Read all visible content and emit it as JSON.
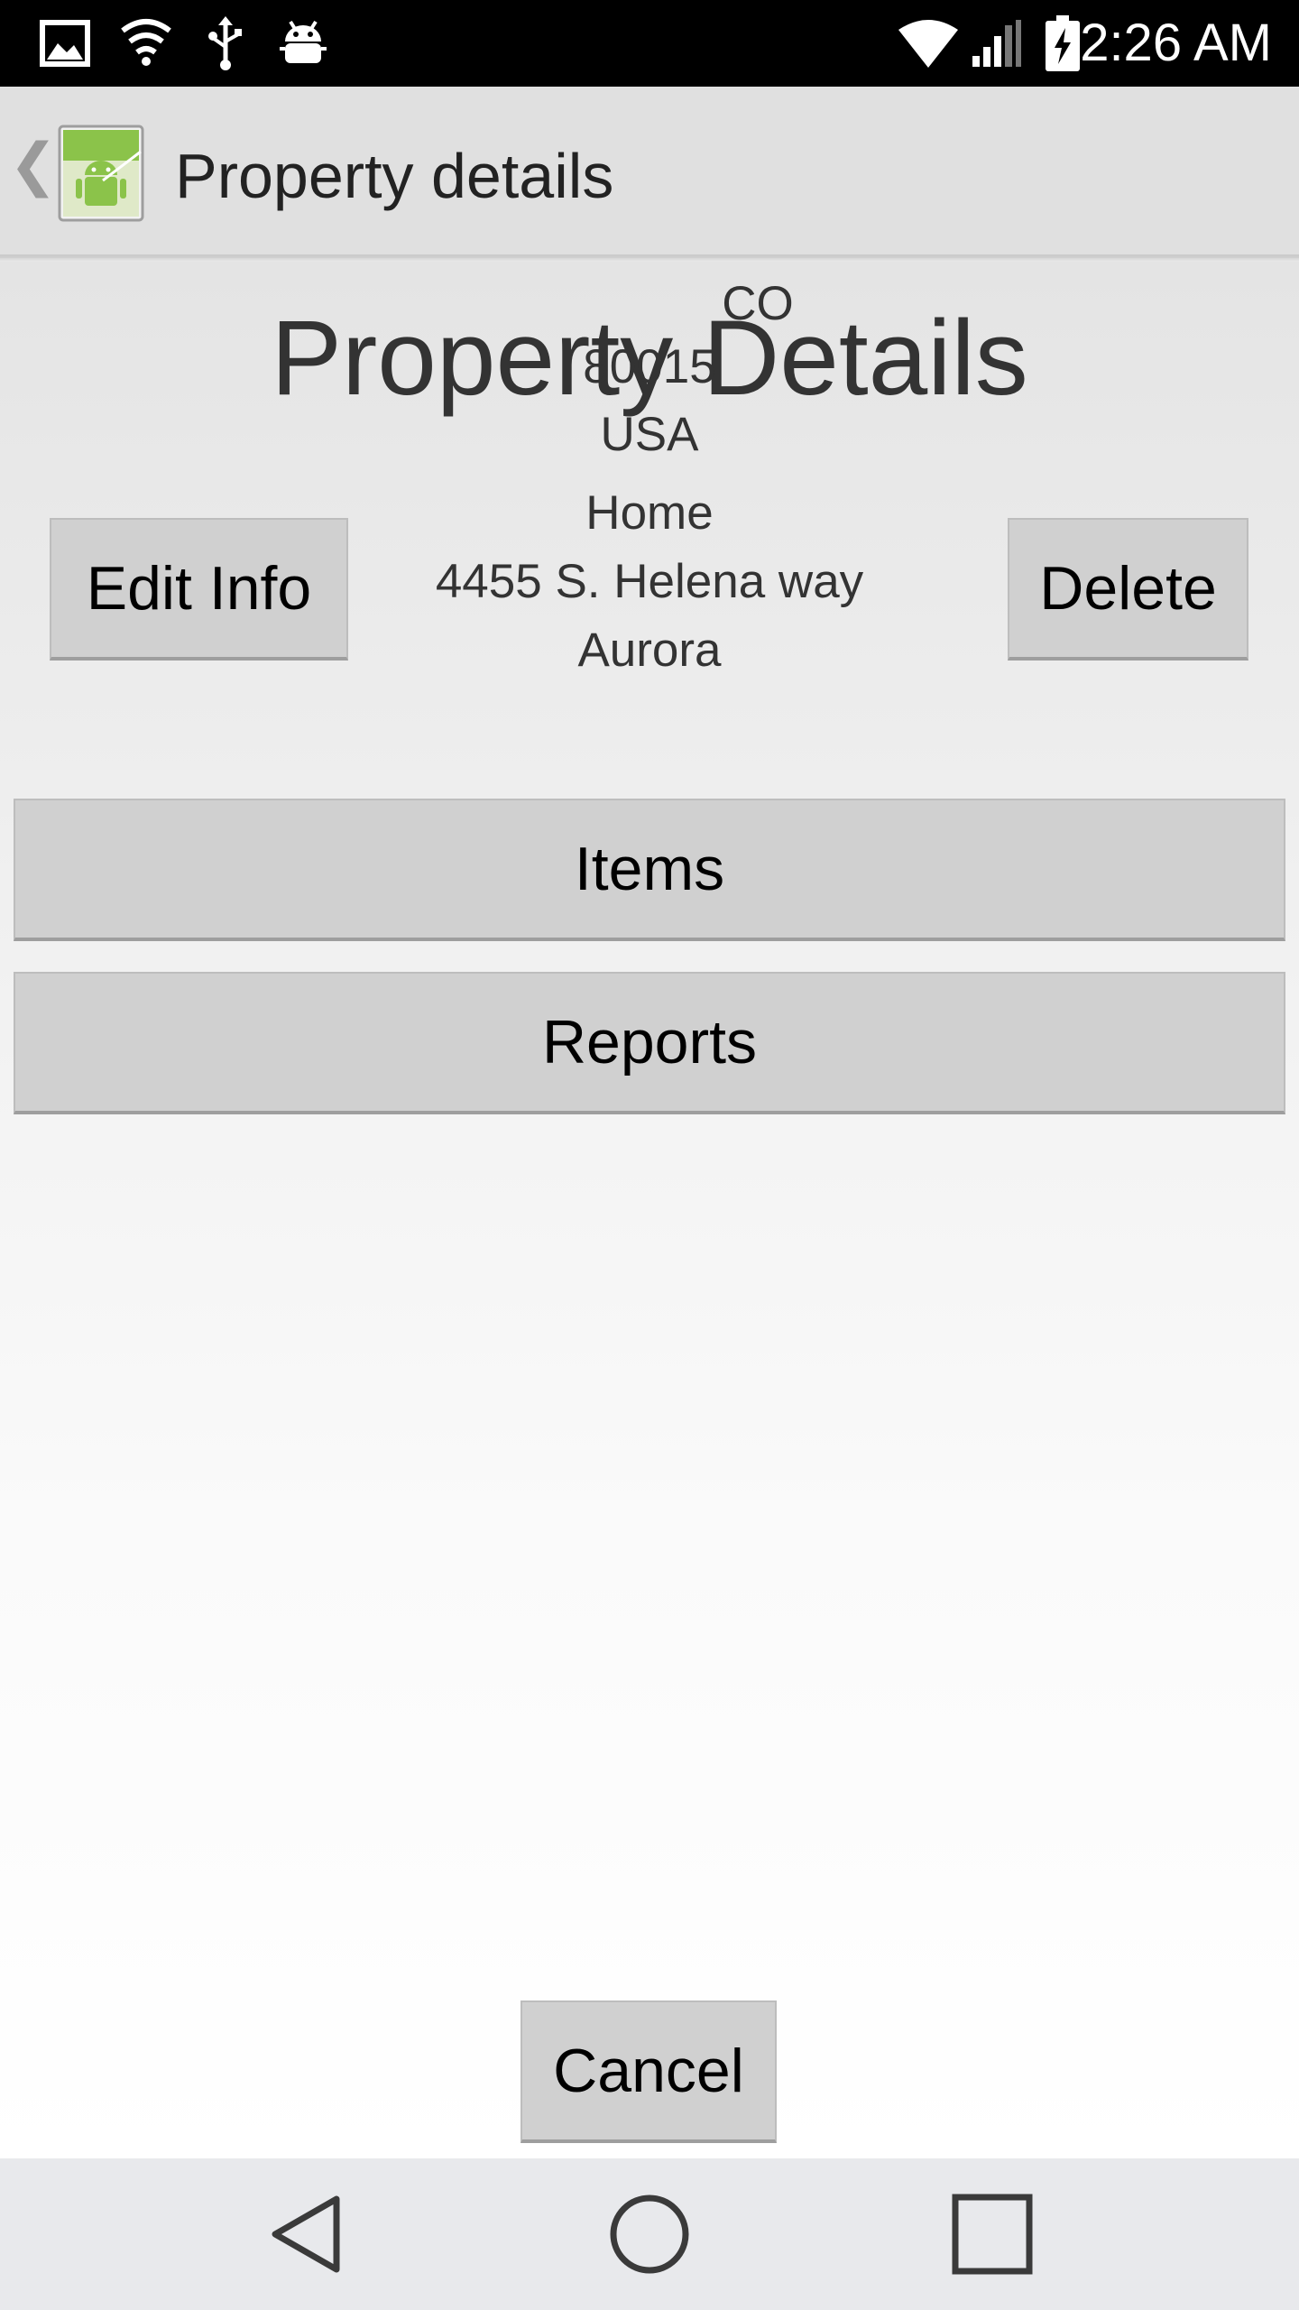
{
  "status_bar": {
    "time": "2:26 AM",
    "left_icons": [
      "image-icon",
      "shield-wifi-icon",
      "usb-icon",
      "android-debug-icon"
    ],
    "right_icons": [
      "wifi-icon",
      "signal-icon",
      "battery-charging-icon"
    ]
  },
  "action_bar": {
    "title": "Property details"
  },
  "main": {
    "page_title": "Property Details",
    "address": {
      "state": "CO",
      "zip": "80015",
      "country": "USA",
      "name": "Home",
      "street": "4455 S. Helena way",
      "city": "Aurora"
    },
    "edit_button": "Edit Info",
    "delete_button": "Delete",
    "items_button": "Items",
    "reports_button": "Reports",
    "cancel_button": "Cancel"
  },
  "nav_bar": {
    "icons": [
      "back-icon",
      "home-icon",
      "recents-icon"
    ]
  },
  "colors": {
    "status_bar_bg": "#000000",
    "action_bar_bg": "#e0e0e0",
    "button_bg": "#d0d0d0",
    "nav_bar_bg": "#e8e9ec"
  }
}
